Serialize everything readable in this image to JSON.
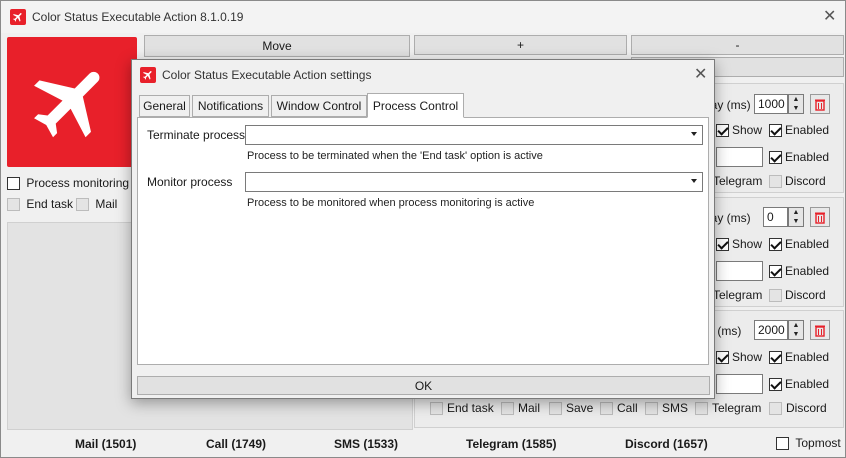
{
  "window": {
    "title": "Color Status Executable Action 8.1.0.19"
  },
  "toolbar": {
    "move_label": "Move",
    "plus_label": "+",
    "minus_label": "-"
  },
  "left": {
    "process_monitoring_label": "Process monitoring",
    "end_task_label": "End task",
    "mail_label": "Mail"
  },
  "panels": [
    {
      "delay_label": "lay (ms)",
      "delay_value": "1000",
      "show_label": "Show",
      "enabled1_label": "Enabled",
      "enabled2_label": "Enabled",
      "telegram_label": "Telegram",
      "discord_label": "Discord"
    },
    {
      "delay_label": "lay (ms)",
      "delay_value": "0",
      "show_label": "Show",
      "enabled1_label": "Enabled",
      "enabled2_label": "Enabled",
      "telegram_label": "Telegram",
      "discord_label": "Discord"
    },
    {
      "delay_label": "y (ms)",
      "delay_value": "2000",
      "show_label": "Show",
      "enabled1_label": "Enabled",
      "enabled2_label": "Enabled",
      "telegram_label": "Telegram",
      "discord_label": "Discord"
    }
  ],
  "bottom_row": {
    "end_task": "End task",
    "mail": "Mail",
    "save": "Save",
    "call": "Call",
    "sms": "SMS",
    "telegram": "Telegram",
    "discord": "Discord"
  },
  "status": {
    "mail": "Mail (1501)",
    "call": "Call (1749)",
    "sms": "SMS (1533)",
    "telegram": "Telegram (1585)",
    "discord": "Discord (1657)",
    "topmost_label": "Topmost"
  },
  "dialog": {
    "title": "Color Status Executable Action settings",
    "tabs": [
      "General",
      "Notifications",
      "Window Control",
      "Process Control"
    ],
    "active_tab": "Process Control",
    "terminate_label": "Terminate process",
    "terminate_value": "",
    "terminate_hint": "Process to be terminated when the 'End task' option is active",
    "monitor_label": "Monitor process",
    "monitor_value": "",
    "monitor_hint": "Process to be monitored when process monitoring is active",
    "ok_label": "OK"
  },
  "colors": {
    "brand_red": "#e8202a"
  }
}
